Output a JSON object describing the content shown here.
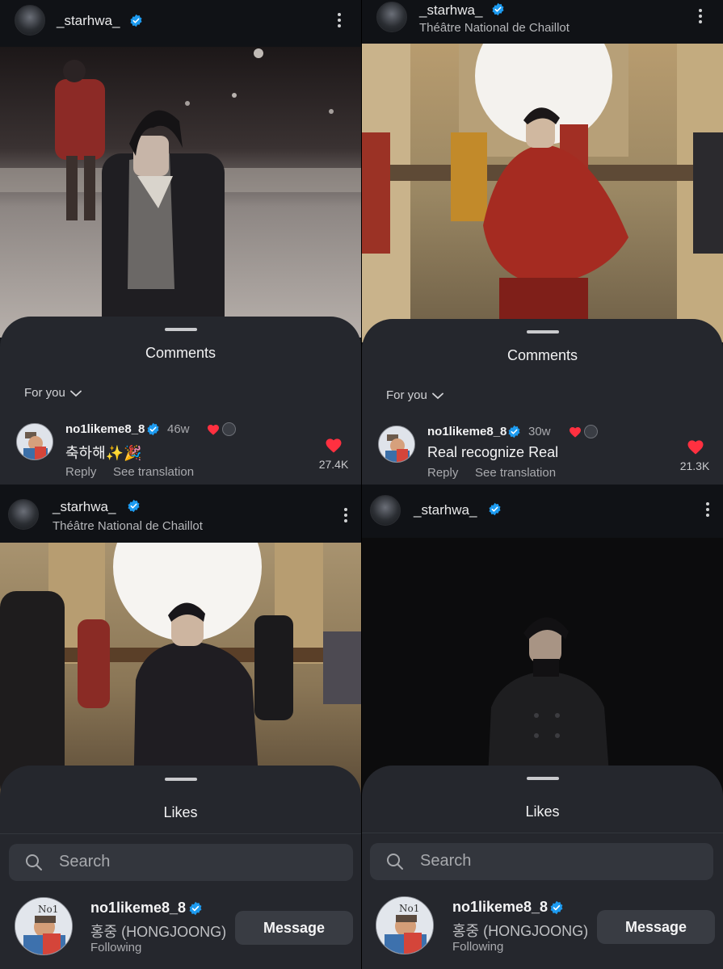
{
  "colors": {
    "sheet_bg": "#25272d",
    "header_bg": "#101216",
    "verified_blue": "#1d9bf0",
    "heart_red": "#ff3040"
  },
  "post_header": {
    "username": "_starhwa_",
    "location": "Théâtre National de Chaillot"
  },
  "icons": [
    "verified-badge-icon",
    "kebab-menu-icon",
    "chevron-down-icon",
    "heart-icon",
    "search-icon"
  ],
  "comments_sheets": [
    {
      "title": "Comments",
      "filter_label": "For you",
      "comment": {
        "username": "no1likeme8_8",
        "time": "46w",
        "text": "축하해✨🎉",
        "reply_label": "Reply",
        "translate_label": "See translation",
        "like_count": "27.4K"
      }
    },
    {
      "title": "Comments",
      "filter_label": "For you",
      "comment": {
        "username": "no1likeme8_8",
        "time": "30w",
        "text": "Real recognize Real",
        "reply_label": "Reply",
        "translate_label": "See translation",
        "like_count": "21.3K"
      }
    }
  ],
  "likes_sheets": [
    {
      "title": "Likes",
      "search_placeholder": "Search",
      "user": {
        "username": "no1likeme8_8",
        "display_name": "홍중 (HONGJOONG)",
        "status": "Following",
        "button_label": "Message"
      }
    },
    {
      "title": "Likes",
      "search_placeholder": "Search",
      "user": {
        "username": "no1likeme8_8",
        "display_name": "홍중 (HONGJOONG)",
        "status": "Following",
        "button_label": "Message"
      }
    }
  ]
}
